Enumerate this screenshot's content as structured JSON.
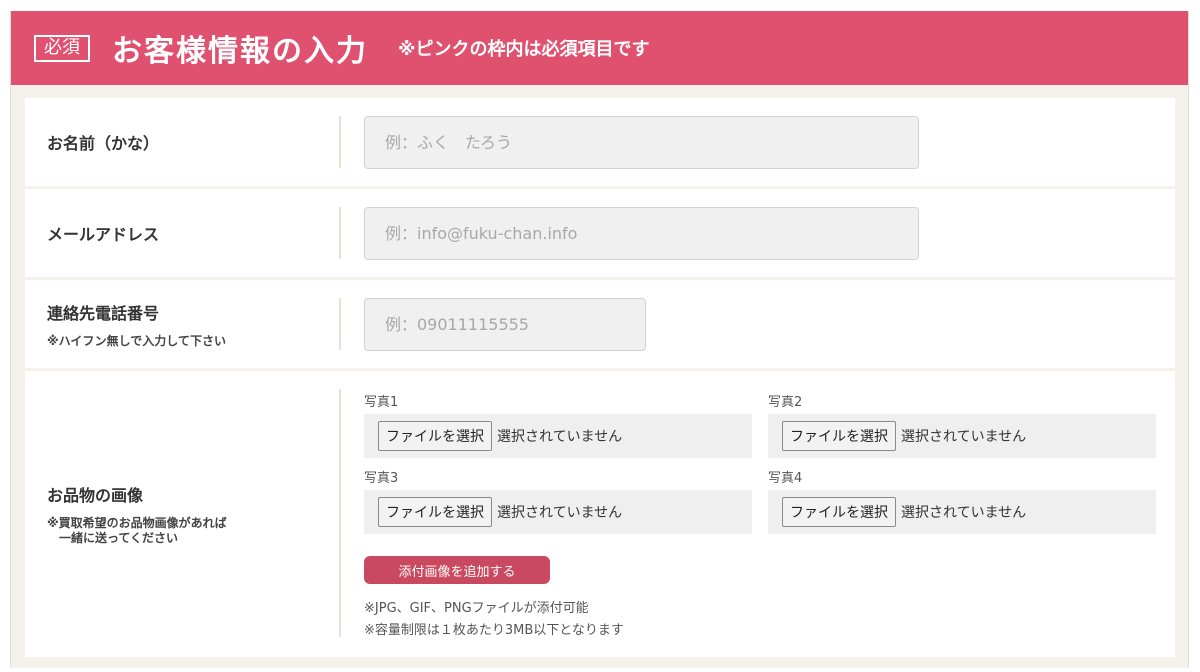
{
  "header": {
    "badge": "必須",
    "title": "お客様情報の入力",
    "note": "※ピンクの枠内は必須項目です",
    "color": "#e0506f"
  },
  "fields": {
    "name": {
      "label": "お名前（かな）",
      "placeholder": "例：ふく　たろう"
    },
    "email": {
      "label": "メールアドレス",
      "placeholder": "例：info@fuku-chan.info"
    },
    "phone": {
      "label": "連絡先電話番号",
      "sub": "※ハイフン無しで入力して下さい",
      "placeholder": "例：09011115555"
    }
  },
  "images": {
    "label": "お品物の画像",
    "sub_line1": "※買取希望のお品物画像があれば",
    "sub_line2": "　一緒に送ってください",
    "photos": [
      {
        "label": "写真1",
        "button": "ファイルを選択",
        "status": "選択されていません"
      },
      {
        "label": "写真2",
        "button": "ファイルを選択",
        "status": "選択されていません"
      },
      {
        "label": "写真3",
        "button": "ファイルを選択",
        "status": "選択されていません"
      },
      {
        "label": "写真4",
        "button": "ファイルを選択",
        "status": "選択されていません"
      }
    ],
    "add_button": "添付画像を追加する",
    "add_button_color": "#c94a60",
    "note1": "※JPG、GIF、PNGファイルが添付可能",
    "note2": "※容量制限は１枚あたり3MB以下となります"
  }
}
